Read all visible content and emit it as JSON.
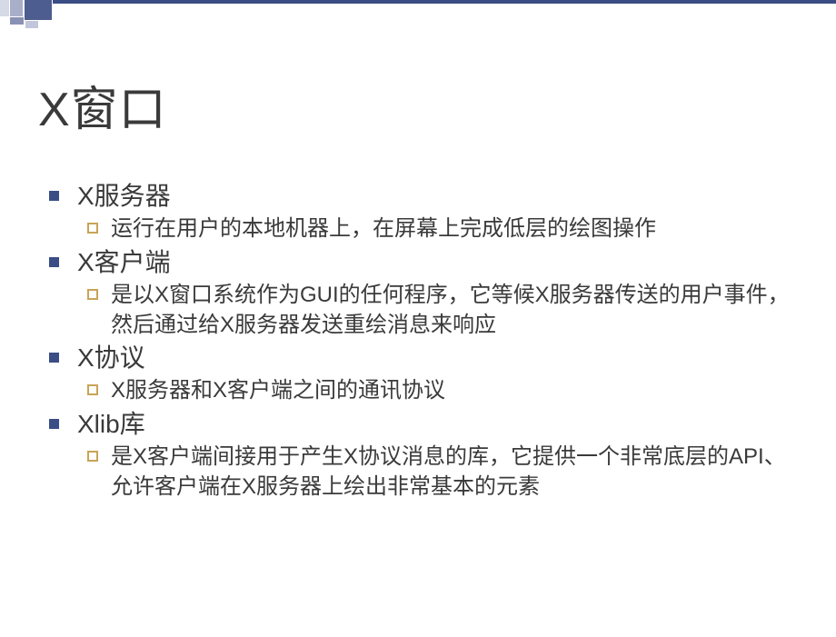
{
  "title": "X窗口",
  "items": [
    {
      "label": "X服务器",
      "sub": [
        "运行在用户的本地机器上，在屏幕上完成低层的绘图操作"
      ]
    },
    {
      "label": "X客户端",
      "sub": [
        "是以X窗口系统作为GUI的任何程序，它等候X服务器传送的用户事件，然后通过给X服务器发送重绘消息来响应"
      ]
    },
    {
      "label": "X协议",
      "sub": [
        "X服务器和X客户端之间的通讯协议"
      ]
    },
    {
      "label": "Xlib库",
      "sub": [
        "是X客户端间接用于产生X协议消息的库，它提供一个非常底层的API、允许客户端在X服务器上绘出非常基本的元素"
      ]
    }
  ]
}
